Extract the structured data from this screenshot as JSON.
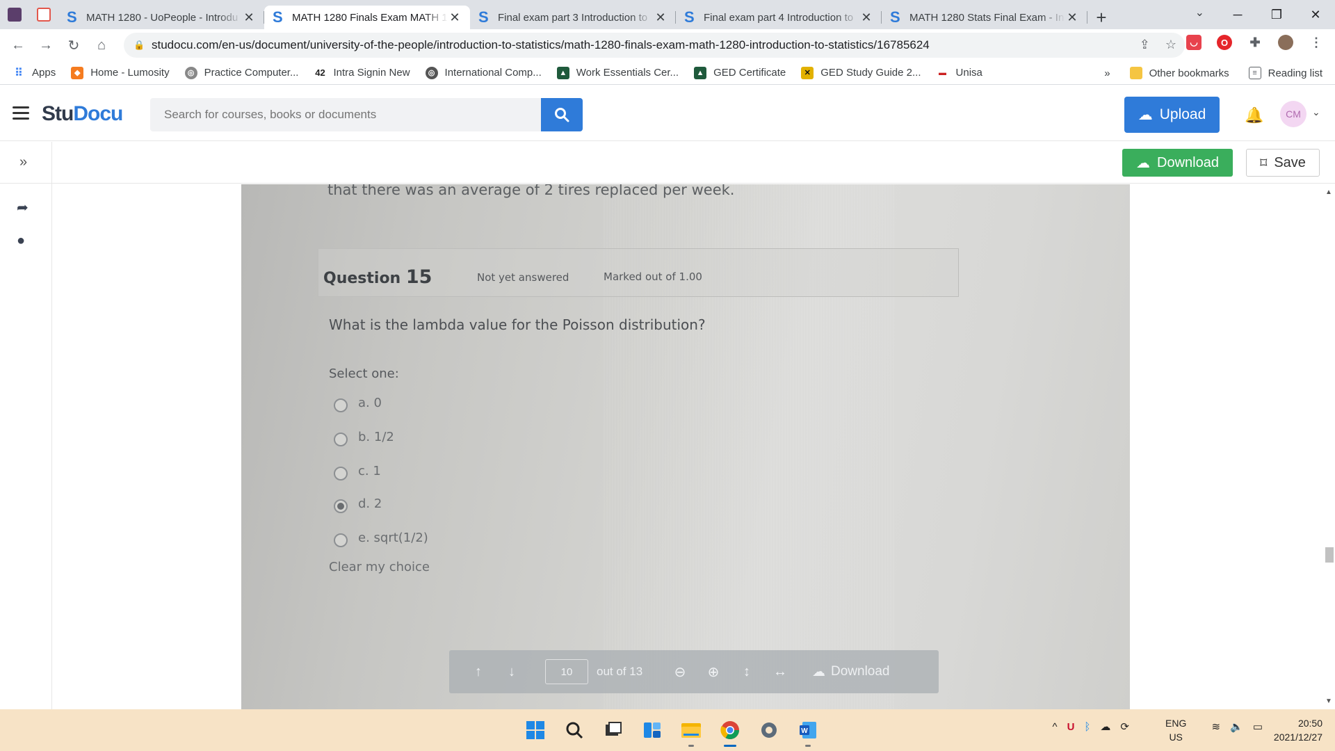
{
  "browser": {
    "tabs": [
      {
        "title": "MATH 1280 - UoPeople - Introdu",
        "active": false
      },
      {
        "title": "MATH 1280 Finals Exam MATH 1",
        "active": true
      },
      {
        "title": "Final exam part 3 Introduction to",
        "active": false
      },
      {
        "title": "Final exam part 4 Introduction to",
        "active": false
      },
      {
        "title": "MATH 1280 Stats Final Exam - In",
        "active": false
      }
    ],
    "favicon_letter": "S",
    "close_glyph": "✕",
    "new_tab_glyph": "+",
    "url": "studocu.com/en-us/document/university-of-the-people/introduction-to-statistics/math-1280-finals-exam-math-1280-introduction-to-statistics/16785624",
    "bookmarks": [
      {
        "label": "Apps",
        "color": "#4285f4"
      },
      {
        "label": "Home - Lumosity",
        "color": "#f57c20"
      },
      {
        "label": "Practice Computer...",
        "color": "#888888"
      },
      {
        "label": "Intra Signin New",
        "color": "#222222"
      },
      {
        "label": "International Comp...",
        "color": "#555555"
      },
      {
        "label": "Work Essentials Cer...",
        "color": "#1f5a3c"
      },
      {
        "label": "GED Certificate",
        "color": "#1f5a3c"
      },
      {
        "label": "GED Study Guide 2...",
        "color": "#e2b100"
      },
      {
        "label": "Unisa",
        "color": "#cc2222"
      }
    ],
    "bookmarks_overflow": "»",
    "other_bookmarks": "Other bookmarks",
    "reading_list": "Reading list"
  },
  "studocu": {
    "logo_part1": "Stu",
    "logo_part2": "Docu",
    "search_placeholder": "Search for courses, books or documents",
    "upload_label": "Upload",
    "avatar_initials": "CM",
    "download_label": "Download",
    "save_label": "Save"
  },
  "document": {
    "top_line": "that there was an average of 2 tires replaced per week.",
    "question_label": "Question",
    "question_number": "15",
    "status": "Not yet answered",
    "marks": "Marked out of 1.00",
    "question_text": "What is the lambda value for the Poisson distribution?",
    "select_prompt": "Select one:",
    "options": [
      {
        "label": "a. 0",
        "checked": false
      },
      {
        "label": "b. 1/2",
        "checked": false
      },
      {
        "label": "c. 1",
        "checked": false
      },
      {
        "label": "d. 2",
        "checked": true
      },
      {
        "label": "e. sqrt(1/2)",
        "checked": false
      }
    ],
    "clear_choice": "Clear my choice"
  },
  "pager": {
    "current_page": "10",
    "out_of": "out of 13",
    "download_label": "Download"
  },
  "taskbar": {
    "lang_top": "ENG",
    "lang_bottom": "US",
    "time": "20:50",
    "date": "2021/12/27"
  },
  "colors": {
    "studocu_blue": "#2f7bd9",
    "download_green": "#3aae5c",
    "taskbar": "#f7e3c6"
  }
}
